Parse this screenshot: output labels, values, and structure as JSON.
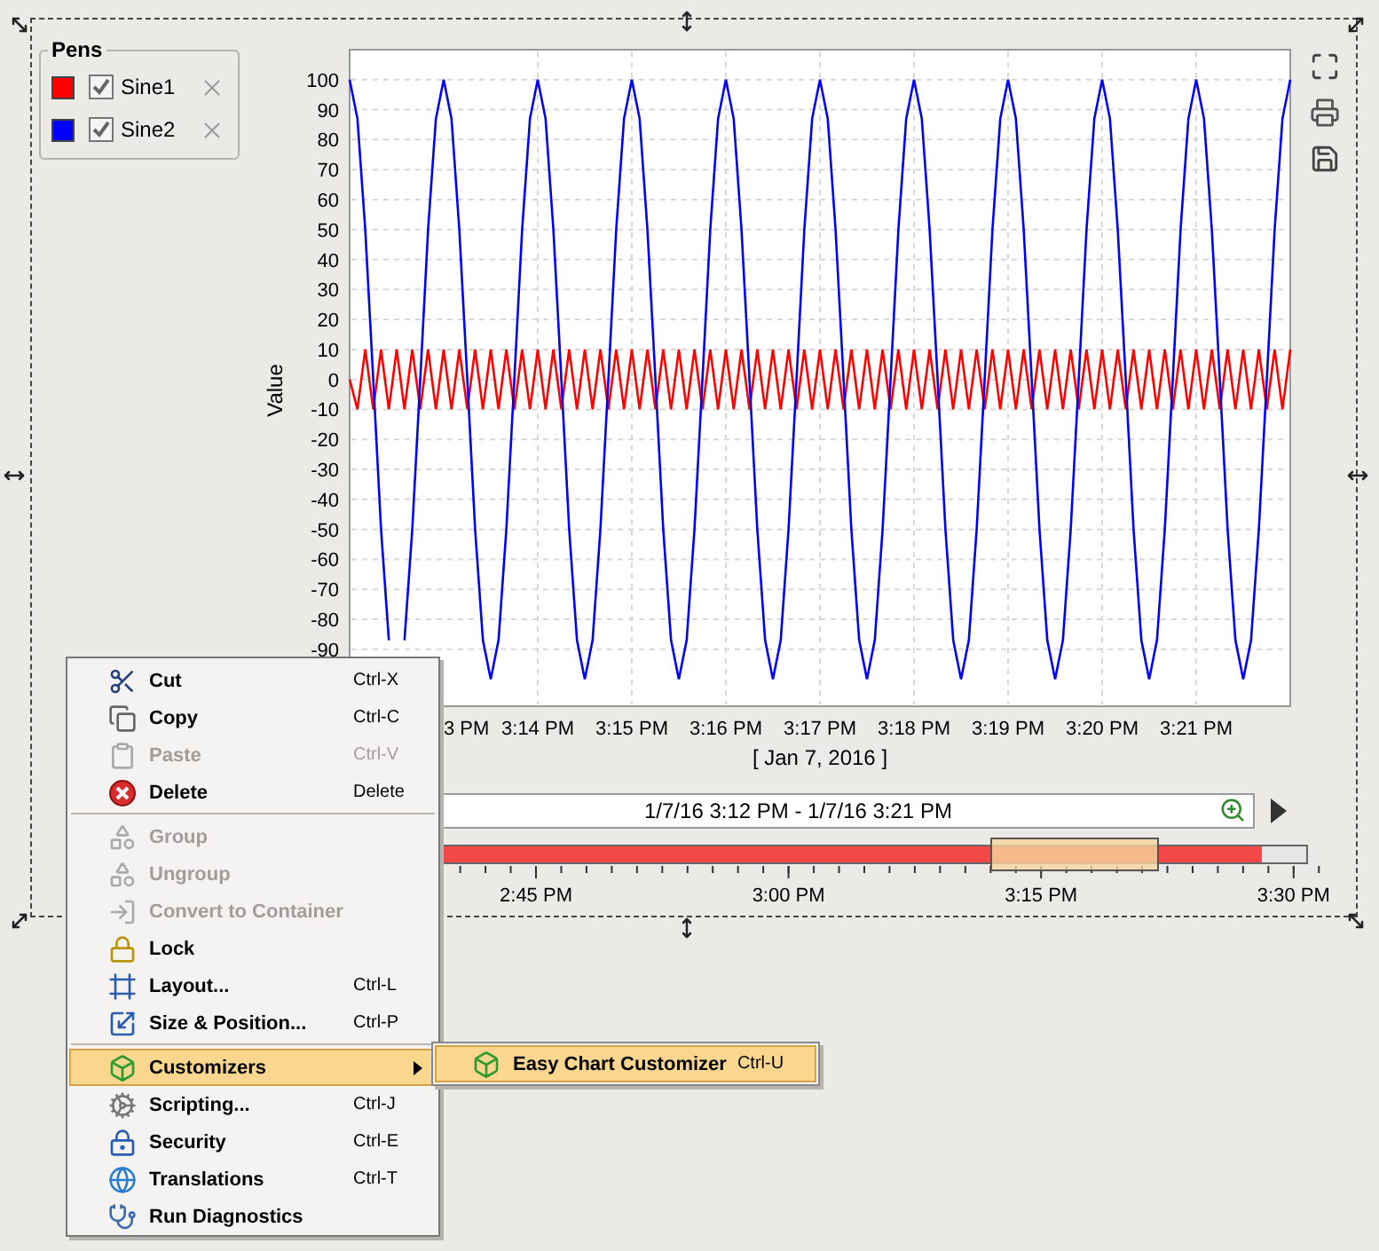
{
  "pens": {
    "title": "Pens",
    "items": [
      {
        "checked": true
      },
      {
        "checked": true
      }
    ]
  },
  "chart": {
    "cut_tick_label": "3 PM",
    "chart_data": {
      "type": "line",
      "grid": true,
      "xlabel": "[ Jan 7, 2016 ]",
      "ylabel": "Value",
      "ylim": [
        -109,
        110
      ],
      "categories": [
        null,
        null,
        null,
        null,
        null,
        null,
        null,
        null,
        null,
        null,
        null,
        null,
        null,
        null,
        null,
        null,
        null,
        null,
        null,
        null,
        null,
        null,
        null,
        null,
        "3:14 PM",
        null,
        null,
        null,
        null,
        null,
        null,
        null,
        null,
        null,
        null,
        null,
        "3:15 PM",
        null,
        null,
        null,
        null,
        null,
        null,
        null,
        null,
        null,
        null,
        null,
        "3:16 PM",
        null,
        null,
        null,
        null,
        null,
        null,
        null,
        null,
        null,
        null,
        null,
        "3:17 PM",
        null,
        null,
        null,
        null,
        null,
        null,
        null,
        null,
        null,
        null,
        null,
        "3:18 PM",
        null,
        null,
        null,
        null,
        null,
        null,
        null,
        null,
        null,
        null,
        null,
        "3:19 PM",
        null,
        null,
        null,
        null,
        null,
        null,
        null,
        null,
        null,
        null,
        null,
        "3:20 PM",
        null,
        null,
        null,
        null,
        null,
        null,
        null,
        null,
        null,
        null,
        null,
        "3:21 PM",
        null,
        null,
        null,
        null,
        null,
        null,
        null,
        null,
        null,
        null,
        null,
        null
      ],
      "yticks": [
        100,
        90,
        80,
        70,
        60,
        50,
        40,
        30,
        20,
        10,
        0,
        -10,
        -20,
        -30,
        -40,
        -50,
        -60,
        -70,
        -80,
        -90
      ],
      "series": [
        {
          "name": "Sine1",
          "color": "#ff0000",
          "values": [
            0,
            -10,
            10,
            -10,
            10,
            -10,
            10,
            -10,
            10,
            -10,
            10,
            -10,
            10,
            -10,
            10,
            -10,
            10,
            -10,
            10,
            -10,
            10,
            -10,
            10,
            -10,
            10,
            -10,
            10,
            -10,
            10,
            -10,
            10,
            -10,
            10,
            -10,
            10,
            -10,
            10,
            -10,
            10,
            -10,
            10,
            -10,
            10,
            -10,
            10,
            -10,
            10,
            -10,
            10,
            -10,
            10,
            -10,
            10,
            -10,
            10,
            -10,
            10,
            -10,
            10,
            -10,
            10,
            -10,
            10,
            -10,
            10,
            -10,
            10,
            -10,
            10,
            -10,
            10,
            -10,
            10,
            -10,
            10,
            -10,
            10,
            -10,
            10,
            -10,
            10,
            -10,
            10,
            -10,
            10,
            -10,
            10,
            -10,
            10,
            -10,
            10,
            -10,
            10,
            -10,
            10,
            -10,
            10,
            -10,
            10,
            -10,
            10,
            -10,
            10,
            -10,
            10,
            -10,
            10,
            -10,
            10,
            -10,
            10,
            -10,
            10,
            -10,
            10,
            -10,
            10,
            -10,
            10,
            -10,
            10
          ]
        },
        {
          "name": "Sine2",
          "color": "#0000ff",
          "values": [
            100,
            87,
            50,
            0,
            -50,
            -87,
            null,
            -87,
            -50,
            0,
            50,
            87,
            100,
            87,
            50,
            0,
            -50,
            -87,
            -100,
            -87,
            -50,
            0,
            50,
            87,
            100,
            87,
            50,
            0,
            -50,
            -87,
            -100,
            -87,
            -50,
            0,
            50,
            87,
            100,
            87,
            50,
            0,
            -50,
            -87,
            -100,
            -87,
            -50,
            0,
            50,
            87,
            100,
            87,
            50,
            0,
            -50,
            -87,
            -100,
            -87,
            -50,
            0,
            50,
            87,
            100,
            87,
            50,
            0,
            -50,
            -87,
            -100,
            -87,
            -50,
            0,
            50,
            87,
            100,
            87,
            50,
            0,
            -50,
            -87,
            -100,
            -87,
            -50,
            0,
            50,
            87,
            100,
            87,
            50,
            0,
            -50,
            -87,
            -100,
            -87,
            -50,
            0,
            50,
            87,
            100,
            87,
            50,
            0,
            -50,
            -87,
            -100,
            -87,
            -50,
            0,
            50,
            87,
            100,
            87,
            50,
            0,
            -50,
            -87,
            -100,
            -87,
            -50,
            0,
            50,
            87,
            100
          ]
        }
      ]
    }
  },
  "range_field": {
    "value": "1/7/16 3:12 PM - 1/7/16 3:21 PM"
  },
  "timeline": {
    "level": 0.955,
    "tick_labels": [
      "2:45 PM",
      "3:00 PM",
      "3:15 PM",
      "3:30 PM"
    ]
  },
  "context_menu": {
    "sections": [
      {
        "items": [
          {
            "label": "Cut",
            "shortcut": "Ctrl-X",
            "disabled": false,
            "selected": false,
            "submenu": false
          },
          {
            "label": "Copy",
            "shortcut": "Ctrl-C",
            "disabled": false,
            "selected": false,
            "submenu": false
          },
          {
            "label": "Paste",
            "shortcut": "Ctrl-V",
            "disabled": true,
            "selected": false,
            "submenu": false
          },
          {
            "label": "Delete",
            "shortcut": "Delete",
            "disabled": false,
            "selected": false,
            "submenu": false
          }
        ]
      },
      {
        "items": [
          {
            "label": "Group",
            "disabled": true,
            "selected": false,
            "submenu": false
          },
          {
            "label": "Ungroup",
            "disabled": true,
            "selected": false,
            "submenu": false
          },
          {
            "label": "Convert to Container",
            "disabled": true,
            "selected": false,
            "submenu": false
          },
          {
            "label": "Lock",
            "disabled": false,
            "selected": false,
            "submenu": false
          },
          {
            "label": "Layout...",
            "shortcut": "Ctrl-L",
            "disabled": false,
            "selected": false,
            "submenu": false
          },
          {
            "label": "Size & Position...",
            "shortcut": "Ctrl-P",
            "disabled": false,
            "selected": false,
            "submenu": false
          }
        ]
      },
      {
        "items": [
          {
            "label": "Customizers",
            "disabled": false,
            "selected": true,
            "submenu": true
          },
          {
            "label": "Scripting...",
            "shortcut": "Ctrl-J",
            "disabled": false,
            "selected": false,
            "submenu": false
          },
          {
            "label": "Security",
            "shortcut": "Ctrl-E",
            "disabled": false,
            "selected": false,
            "submenu": false
          },
          {
            "label": "Translations",
            "shortcut": "Ctrl-T",
            "disabled": false,
            "selected": false,
            "submenu": false
          },
          {
            "label": "Run Diagnostics",
            "disabled": false,
            "selected": false,
            "submenu": false
          }
        ]
      }
    ]
  },
  "submenu": {
    "items": [
      {
        "label": "Easy Chart Customizer",
        "shortcut": "Ctrl-U",
        "selected": true
      }
    ]
  }
}
